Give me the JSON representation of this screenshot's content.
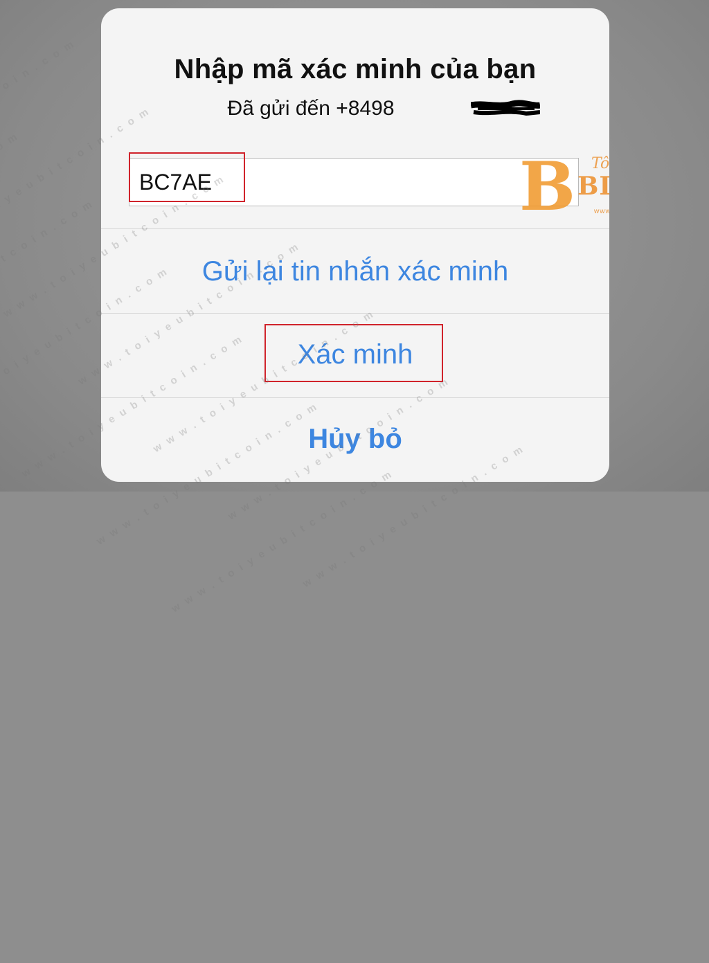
{
  "dialog": {
    "title": "Nhập mã xác minh của bạn",
    "subtitle": "Đã gửi đến +8498",
    "code_value": "BC7AE",
    "resend_label": "Gửi lại tin nhắn xác minh",
    "verify_label": "Xác minh",
    "cancel_label": "Hủy bỏ"
  },
  "logo": {
    "coin_letter": "B",
    "small_text": "Tôi Yêu",
    "main_text": "BITCOIN",
    "url": "www.toiyeubitcoin.com"
  },
  "watermark_text": "w w w . t o i y e u b i t c o i n . c o m",
  "colors": {
    "accent_blue": "#3d86e0",
    "highlight_red": "#d0232b",
    "logo_orange": "#f0962a"
  }
}
